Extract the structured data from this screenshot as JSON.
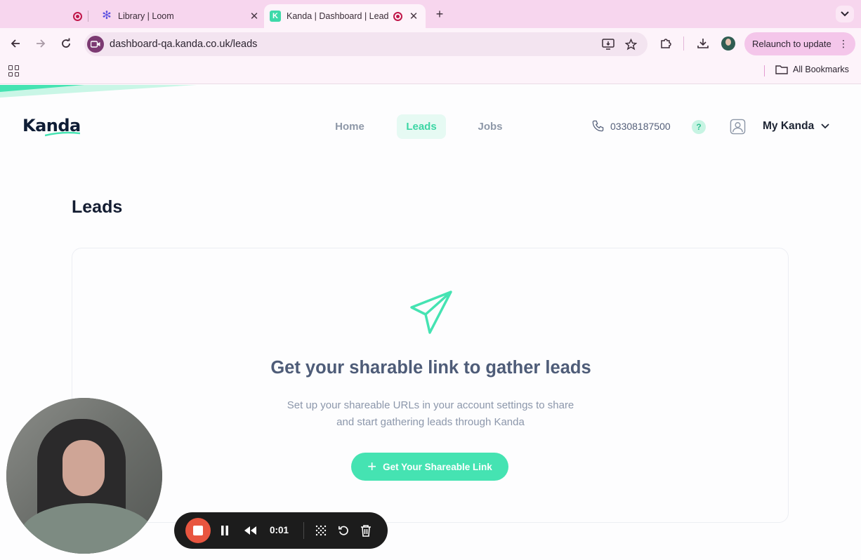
{
  "browser": {
    "tabs": [
      {
        "title": "",
        "favicon": "recording-dot-icon",
        "active": false
      },
      {
        "title": "Library | Loom",
        "favicon": "loom-icon",
        "active": false
      },
      {
        "title": "Kanda | Dashboard | Leads",
        "favicon": "kanda-icon",
        "active": true
      }
    ],
    "url": "dashboard-qa.kanda.co.uk/leads",
    "relaunch_label": "Relaunch to update",
    "all_bookmarks_label": "All Bookmarks",
    "favicon_letter": "K"
  },
  "app": {
    "logo_text": "Kanda",
    "nav": {
      "home": "Home",
      "leads": "Leads",
      "jobs": "Jobs",
      "active": "Leads"
    },
    "phone": "03308187500",
    "help_label": "?",
    "account_label": "My Kanda",
    "page_title": "Leads",
    "empty_state": {
      "title": "Get your sharable link to gather leads",
      "description_line1": "Set up your shareable URLs in your account settings to share",
      "description_line2": "and start gathering leads through Kanda",
      "button_label": "Get Your Shareable Link",
      "button_icon": "plus"
    },
    "colors": {
      "accent": "#45e3b2",
      "accent_text": "#3bd6a4",
      "nav_active_bg": "#e6faf3",
      "title": "#131c31"
    }
  },
  "loom": {
    "timer": "0:01",
    "stop_color": "#e8553f"
  }
}
